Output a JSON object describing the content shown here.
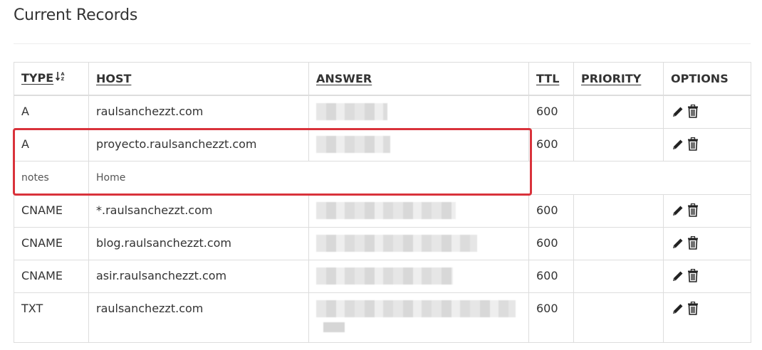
{
  "page": {
    "title": "Current Records"
  },
  "table": {
    "headers": {
      "type": "TYPE",
      "host": "HOST",
      "answer": "ANSWER",
      "ttl": "TTL",
      "priority": "PRIORITY",
      "options": "OPTIONS"
    },
    "sort_icon": "sort-alpha-icon",
    "rows": [
      {
        "type": "A",
        "host": "raulsanchezzt.com",
        "answer": "",
        "ttl": "600",
        "priority": ""
      },
      {
        "type": "A",
        "host": "proyecto.raulsanchezzt.com",
        "answer": "",
        "ttl": "600",
        "priority": "",
        "notes_label": "notes",
        "notes_value": "Home"
      },
      {
        "type": "CNAME",
        "host": "*.raulsanchezzt.com",
        "answer": "",
        "ttl": "600",
        "priority": ""
      },
      {
        "type": "CNAME",
        "host": "blog.raulsanchezzt.com",
        "answer": "",
        "ttl": "600",
        "priority": ""
      },
      {
        "type": "CNAME",
        "host": "asir.raulsanchezzt.com",
        "answer": "",
        "ttl": "600",
        "priority": ""
      },
      {
        "type": "TXT",
        "host": "raulsanchezzt.com",
        "answer": "",
        "ttl": "600",
        "priority": ""
      }
    ]
  },
  "colors": {
    "highlight": "#d9323b",
    "border": "#dddddd",
    "text": "#333333"
  }
}
